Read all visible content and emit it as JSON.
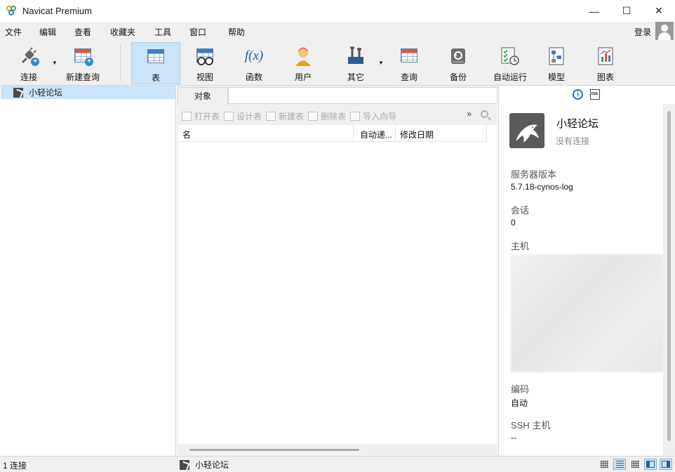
{
  "window": {
    "title": "Navicat Premium",
    "controls": {
      "minimize": "—",
      "maximize": "☐",
      "close": "✕"
    }
  },
  "menu": {
    "items": [
      "文件",
      "编辑",
      "查看",
      "收藏夹",
      "工具",
      "窗口",
      "帮助"
    ],
    "login": "登录"
  },
  "toolbar": {
    "buttons": [
      {
        "label": "连接",
        "icon": "plug-icon"
      },
      {
        "label": "新建查询",
        "icon": "new-query-icon"
      },
      {
        "label": "表",
        "icon": "table-icon",
        "active": true
      },
      {
        "label": "视图",
        "icon": "view-icon"
      },
      {
        "label": "函数",
        "icon": "function-icon",
        "glyph": "f(x)"
      },
      {
        "label": "用户",
        "icon": "user-icon"
      },
      {
        "label": "其它",
        "icon": "tools-icon"
      },
      {
        "label": "查询",
        "icon": "query-icon"
      },
      {
        "label": "备份",
        "icon": "backup-icon"
      },
      {
        "label": "自动运行",
        "icon": "schedule-icon"
      },
      {
        "label": "模型",
        "icon": "model-icon"
      },
      {
        "label": "图表",
        "icon": "chart-icon"
      }
    ]
  },
  "sidebar": {
    "items": [
      {
        "label": "小轻论坛",
        "selected": true
      }
    ]
  },
  "objects": {
    "tab": "对象",
    "actions": [
      "打开表",
      "设计表",
      "新建表",
      "删除表",
      "导入向导"
    ],
    "more": "»",
    "columns": [
      "名",
      "自动递...",
      "修改日期"
    ]
  },
  "details": {
    "info_icon": "i",
    "ddl_icon": "DDL",
    "name": "小轻论坛",
    "status": "没有连接",
    "props": [
      {
        "label": "服务器版本",
        "value": "5.7.18-cynos-log"
      },
      {
        "label": "会话",
        "value": "0"
      },
      {
        "label": "主机",
        "value": ""
      },
      {
        "label": "编码",
        "value": "自动"
      },
      {
        "label": "SSH 主机",
        "value": "--"
      }
    ]
  },
  "statusbar": {
    "left": "1 连接",
    "connection": "小轻论坛"
  },
  "colors": {
    "accent": "#cce4f7",
    "link_blue": "#1a73c8",
    "toolbar_bg": "#f0f0f0"
  }
}
